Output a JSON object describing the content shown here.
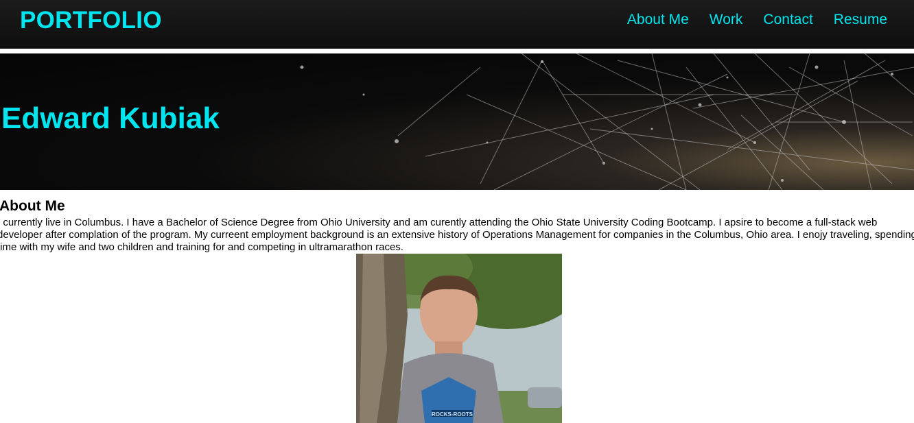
{
  "nav": {
    "brand": "PORTFOLIO",
    "links": [
      "About Me",
      "Work",
      "Contact",
      "Resume"
    ]
  },
  "hero": {
    "name": "Edward Kubiak"
  },
  "about": {
    "heading": "About Me",
    "text": "I currently live in Columbus. I have a Bachelor of Science Degree from Ohio University and am curently attending the Ohio State University Coding Bootcamp. I apsire to become a full-stack web developer after complation of the program. My curreent employment background is an extensive history of Operations Management for companies in the Columbus, Ohio area. I enojy traveling, spending time with my wife and two children and training for and competing in ultramarathon races."
  },
  "photo": {
    "shirt_text": "ROCKS-ROOTS"
  },
  "colors": {
    "accent": "#00e6f0",
    "nav_bg": "#121212"
  }
}
